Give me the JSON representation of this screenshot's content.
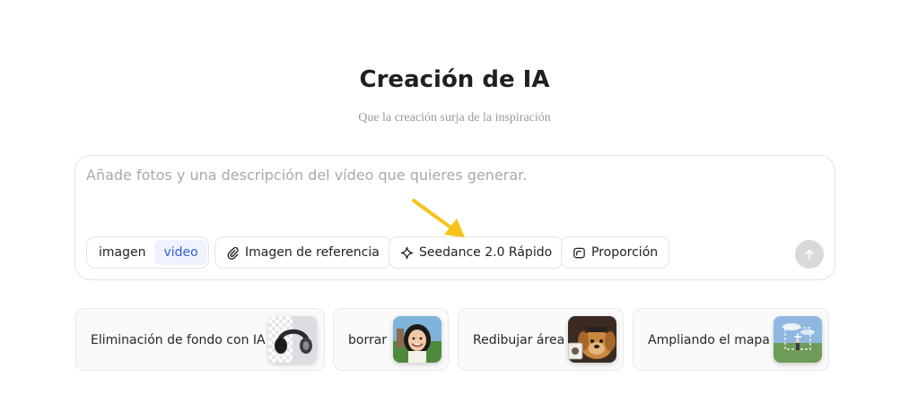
{
  "header": {
    "title": "Creación de IA",
    "subtitle": "Que la creación surja de la inspiración"
  },
  "composer": {
    "placeholder": "Añade fotos y una descripción del vídeo que quieres generar.",
    "value": "",
    "mode_toggle": {
      "options": [
        "imagen",
        "video"
      ],
      "selected": "video"
    },
    "reference_button": {
      "label": "Imagen de referencia",
      "icon": "paperclip-icon"
    },
    "model_button": {
      "label": "Seedance 2.0 Rápido",
      "icon": "sparkle-icon"
    },
    "ratio_button": {
      "label": "Proporción",
      "icon": "aspect-ratio-icon"
    },
    "send_button": {
      "icon": "arrow-up-icon",
      "enabled": false
    }
  },
  "annotation": {
    "arrow_color": "#f7c31a"
  },
  "tools": [
    {
      "label": "Eliminación de fondo con IA",
      "thumbnail": "headphones-thumbnail"
    },
    {
      "label": "borrar",
      "thumbnail": "girl-portrait-thumbnail"
    },
    {
      "label": "Redibujar área",
      "thumbnail": "dog-thumbnail"
    },
    {
      "label": "Ampliando el mapa",
      "thumbnail": "landscape-thumbnail"
    }
  ],
  "colors": {
    "accent": "#2f5fd0",
    "accent_bg": "#eef3ff",
    "border": "#e3e3e3",
    "send_disabled": "#d9d9d9"
  }
}
